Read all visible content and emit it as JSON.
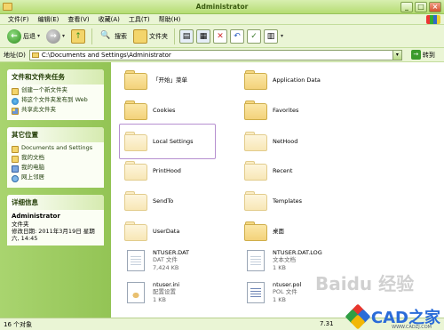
{
  "window": {
    "title": "Administrator",
    "controls": {
      "minimize": "_",
      "maximize": "□",
      "close": "×"
    }
  },
  "menu": [
    "文件(F)",
    "编辑(E)",
    "查看(V)",
    "收藏(A)",
    "工具(T)",
    "帮助(H)"
  ],
  "toolbar": {
    "back_label": "后退",
    "search_label": "搜索",
    "folders_label": "文件夹"
  },
  "address": {
    "label": "地址(D)",
    "value": "C:\\Documents and Settings\\Administrator",
    "go_label": "转到"
  },
  "sidebar": {
    "tasks": {
      "title": "文件和文件夹任务",
      "items": [
        "创建一个新文件夹",
        "将这个文件夹发布到 Web",
        "共享此文件夹"
      ]
    },
    "places": {
      "title": "其它位置",
      "items": [
        "Documents and Settings",
        "我的文档",
        "我的电脑",
        "网上邻居"
      ]
    },
    "details": {
      "title": "详细信息",
      "name": "Administrator",
      "type": "文件夹",
      "modified": "修改日期: 2011年3月19日 星期六, 14:45"
    }
  },
  "files": [
    {
      "name": "「开始」菜单",
      "kind": "folder"
    },
    {
      "name": "Application Data",
      "kind": "folder"
    },
    {
      "name": "Cookies",
      "kind": "folder"
    },
    {
      "name": "Favorites",
      "kind": "folder"
    },
    {
      "name": "Local Settings",
      "kind": "folder-hidden",
      "selected": true
    },
    {
      "name": "NetHood",
      "kind": "folder-hidden"
    },
    {
      "name": "PrintHood",
      "kind": "folder-hidden"
    },
    {
      "name": "Recent",
      "kind": "folder-hidden"
    },
    {
      "name": "SendTo",
      "kind": "folder-hidden"
    },
    {
      "name": "Templates",
      "kind": "folder-hidden"
    },
    {
      "name": "UserData",
      "kind": "folder-hidden"
    },
    {
      "name": "桌面",
      "kind": "folder"
    },
    {
      "name": "NTUSER.DAT",
      "kind": "file",
      "type": "DAT 文件",
      "size": "7,424 KB"
    },
    {
      "name": "NTUSER.DAT.LOG",
      "kind": "file",
      "type": "文本文档",
      "size": "1 KB"
    },
    {
      "name": "ntuser.ini",
      "kind": "ini",
      "type": "配置设置",
      "size": "1 KB"
    },
    {
      "name": "ntuser.pol",
      "kind": "pol",
      "type": "POL 文件",
      "size": "1 KB"
    }
  ],
  "status": {
    "count": "16 个对象",
    "size": "7.31"
  },
  "watermark": {
    "brand": "CAD之家",
    "url": "WWW.CADZJ.COM",
    "baidu": "Baidu 经验",
    "colors": [
      "#e8362d",
      "#2f9e44",
      "#2b6cd8",
      "#f2b705"
    ]
  }
}
